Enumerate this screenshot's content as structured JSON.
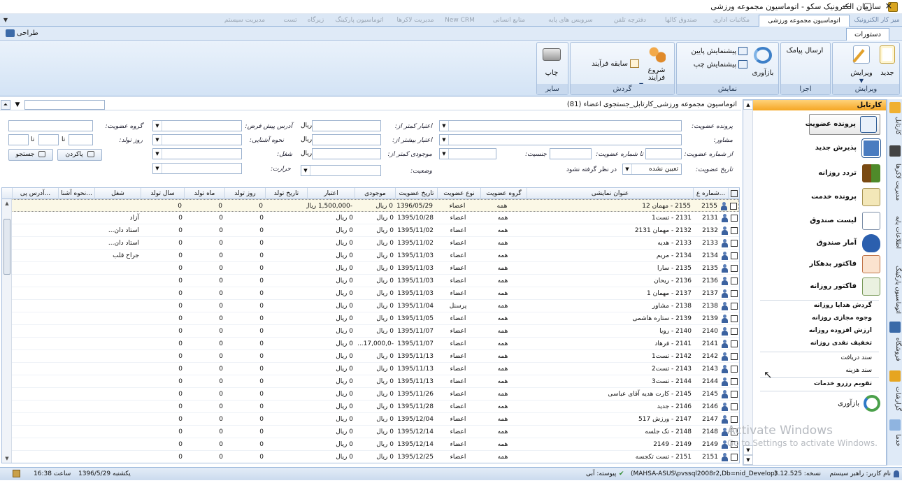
{
  "window": {
    "title": "سازمان الکترونیک سکو - اتوماسیون مجموعه ورزشی",
    "controls": [
      "—",
      "▢",
      "✕"
    ]
  },
  "tabs": [
    {
      "label": "میز کار الکترونیک"
    },
    {
      "label": "اتوماسیون مجموعه ورزشی"
    },
    {
      "label": "مکاتبات اداری"
    },
    {
      "label": "صندوق کالها"
    },
    {
      "label": "دفترچه تلفن"
    },
    {
      "label": "سرویس های پایه"
    },
    {
      "label": "منابع انسانی"
    },
    {
      "label": "New CRM"
    },
    {
      "label": "مدیریت لاکرها"
    },
    {
      "label": "اتوماسیون پارکینگ"
    },
    {
      "label": "زیرگاه"
    },
    {
      "label": "تست"
    },
    {
      "label": "مدیریت سیستم"
    }
  ],
  "subtabs": {
    "commands": "دستورات",
    "design": "طراحی"
  },
  "ribbon": {
    "groups": [
      {
        "caption": "ویرایش",
        "buttons": [
          {
            "label": "جدید"
          },
          {
            "label": "ویرایش"
          }
        ]
      },
      {
        "caption": "اجرا",
        "buttons": [
          {
            "label": "ارسال پیامک"
          }
        ]
      },
      {
        "caption": "نمایش",
        "buttons": [
          {
            "label": "بازآوری"
          },
          {
            "label": "پیشنمایش پایین"
          },
          {
            "label": "پیشنمایش چپ"
          }
        ]
      },
      {
        "caption": "گردش",
        "buttons": [
          {
            "label": "شروع فرآیند"
          },
          {
            "label": "سابقه فرآیند"
          }
        ]
      },
      {
        "caption": "سایر",
        "buttons": [
          {
            "label": "چاپ"
          }
        ]
      }
    ]
  },
  "breadcrumb": "اتوماسیون مجموعه ورزشی_کارتابل_جستجوی اعضاء (81)",
  "filters": {
    "membership_file": "پرونده عضویت:",
    "advisor": "مشاور:",
    "from_member_no": "از شماره عضویت:",
    "to_member_no": "تا شماره عضویت:",
    "gender": "جنسیت:",
    "membership_date": "تاریخ عضویت:",
    "status_value": "تعیین نشده",
    "not_considered": "در نظر گرفته نشود",
    "credit_min": "اعتبار کمتر از:",
    "credit_max": "اعتبار بیشتر از:",
    "balance_min": "موجودی کمتر از:",
    "status": "وضعیت:",
    "currency": "ریال",
    "default_address": "آدرس پیش فرض:",
    "acquaintance": "نحوه آشنایی:",
    "job": "شغل:",
    "temperature": "حرارت:",
    "member_group": "گروه عضویت:",
    "birth_day": "روز تولد:",
    "to_sep": "تا",
    "search_button": "جستجو",
    "clear_button": "پاکردن"
  },
  "grid": {
    "columns": [
      "شماره ع...",
      "عنوان نمایشی",
      "گروه عضویت",
      "نوع عضویت",
      "تاریخ عضویت",
      "موجودی",
      "اعتبار",
      "تاریخ تولد",
      "روز تولد",
      "ماه تولد",
      "سال تولد",
      "شغل",
      "نحوه آشنا...",
      "آدرس پی..."
    ],
    "rows": [
      {
        "no": "2155",
        "title": "2155 - مهمان 12",
        "group": "همه",
        "type": "اعضاء",
        "date": "1396/05/29",
        "balance": "0 ریال",
        "credit": "-1,500,000 ریال",
        "bday": "0",
        "bmonth": "0",
        "byear": "0",
        "job": "",
        "acq": ""
      },
      {
        "no": "2131",
        "title": "2131 - تست1",
        "group": "همه",
        "type": "اعضاء",
        "date": "1395/10/28",
        "balance": "0 ریال",
        "credit": "0 ریال",
        "bday": "0",
        "bmonth": "0",
        "byear": "0",
        "job": "آزاد",
        "acq": ""
      },
      {
        "no": "2132",
        "title": "2132 - مهمان 2131",
        "group": "همه",
        "type": "اعضاء",
        "date": "1395/11/02",
        "balance": "0 ریال",
        "credit": "0 ریال",
        "bday": "0",
        "bmonth": "0",
        "byear": "0",
        "job": "استاد دان...",
        "acq": ""
      },
      {
        "no": "2133",
        "title": "2133 - هدیه",
        "group": "همه",
        "type": "اعضاء",
        "date": "1395/11/02",
        "balance": "0 ریال",
        "credit": "0 ریال",
        "bday": "0",
        "bmonth": "0",
        "byear": "0",
        "job": "استاد دان...",
        "acq": ""
      },
      {
        "no": "2134",
        "title": "2134 - مریم",
        "group": "همه",
        "type": "اعضاء",
        "date": "1395/11/03",
        "balance": "0 ریال",
        "credit": "0 ریال",
        "bday": "0",
        "bmonth": "0",
        "byear": "0",
        "job": "جراح قلب",
        "acq": ""
      },
      {
        "no": "2135",
        "title": "2135 - سارا",
        "group": "همه",
        "type": "اعضاء",
        "date": "1395/11/03",
        "balance": "0 ریال",
        "credit": "0 ریال",
        "bday": "0",
        "bmonth": "0",
        "byear": "0",
        "job": "",
        "acq": ""
      },
      {
        "no": "2136",
        "title": "2136 - ریحان",
        "group": "همه",
        "type": "اعضاء",
        "date": "1395/11/03",
        "balance": "0 ریال",
        "credit": "0 ریال",
        "bday": "0",
        "bmonth": "0",
        "byear": "0",
        "job": "",
        "acq": ""
      },
      {
        "no": "2137",
        "title": "2137 - مهمان 1",
        "group": "همه",
        "type": "اعضاء",
        "date": "1395/11/03",
        "balance": "0 ریال",
        "credit": "0 ریال",
        "bday": "0",
        "bmonth": "0",
        "byear": "0",
        "job": "",
        "acq": ""
      },
      {
        "no": "2138",
        "title": "2138 - مشاور",
        "group": "همه",
        "type": "پرسنل",
        "date": "1395/11/04",
        "balance": "0 ریال",
        "credit": "0 ریال",
        "bday": "0",
        "bmonth": "0",
        "byear": "0",
        "job": "",
        "acq": ""
      },
      {
        "no": "2139",
        "title": "2139 - ستاره هاشمی",
        "group": "همه",
        "type": "اعضاء",
        "date": "1395/11/05",
        "balance": "0 ریال",
        "credit": "0 ریال",
        "bday": "0",
        "bmonth": "0",
        "byear": "0",
        "job": "",
        "acq": ""
      },
      {
        "no": "2140",
        "title": "2140 - رویا",
        "group": "همه",
        "type": "اعضاء",
        "date": "1395/11/07",
        "balance": "0 ریال",
        "credit": "0 ریال",
        "bday": "0",
        "bmonth": "0",
        "byear": "0",
        "job": "",
        "acq": ""
      },
      {
        "no": "2141",
        "title": "2141 - فرهاد",
        "group": "همه",
        "type": "اعضاء",
        "date": "1395/11/07",
        "balance": "-17,000,0...",
        "credit": "0 ریال",
        "bday": "0",
        "bmonth": "0",
        "byear": "0",
        "job": "",
        "acq": ""
      },
      {
        "no": "2142",
        "title": "2142 - تست1",
        "group": "همه",
        "type": "اعضاء",
        "date": "1395/11/13",
        "balance": "0 ریال",
        "credit": "0 ریال",
        "bday": "0",
        "bmonth": "0",
        "byear": "0",
        "job": "",
        "acq": ""
      },
      {
        "no": "2143",
        "title": "2143 - تست2",
        "group": "همه",
        "type": "اعضاء",
        "date": "1395/11/13",
        "balance": "0 ریال",
        "credit": "0 ریال",
        "bday": "0",
        "bmonth": "0",
        "byear": "0",
        "job": "",
        "acq": ""
      },
      {
        "no": "2144",
        "title": "2144 - تست3",
        "group": "همه",
        "type": "اعضاء",
        "date": "1395/11/13",
        "balance": "0 ریال",
        "credit": "0 ریال",
        "bday": "0",
        "bmonth": "0",
        "byear": "0",
        "job": "",
        "acq": ""
      },
      {
        "no": "2145",
        "title": "2145 - کارت هدیه آقای عباسی",
        "group": "همه",
        "type": "اعضاء",
        "date": "1395/11/26",
        "balance": "0 ریال",
        "credit": "0 ریال",
        "bday": "0",
        "bmonth": "0",
        "byear": "0",
        "job": "",
        "acq": ""
      },
      {
        "no": "2146",
        "title": "2146 - جدید",
        "group": "همه",
        "type": "اعضاء",
        "date": "1395/11/28",
        "balance": "0 ریال",
        "credit": "0 ریال",
        "bday": "0",
        "bmonth": "0",
        "byear": "0",
        "job": "",
        "acq": ""
      },
      {
        "no": "2147",
        "title": "2147 - ورزش 517",
        "group": "همه",
        "type": "اعضاء",
        "date": "1395/12/04",
        "balance": "0 ریال",
        "credit": "0 ریال",
        "bday": "0",
        "bmonth": "0",
        "byear": "0",
        "job": "",
        "acq": ""
      },
      {
        "no": "2148",
        "title": "2148 - تک جلسه",
        "group": "همه",
        "type": "اعضاء",
        "date": "1395/12/14",
        "balance": "0 ریال",
        "credit": "0 ریال",
        "bday": "0",
        "bmonth": "0",
        "byear": "0",
        "job": "",
        "acq": ""
      },
      {
        "no": "2149",
        "title": "2149 - 2149",
        "group": "همه",
        "type": "اعضاء",
        "date": "1395/12/14",
        "balance": "0 ریال",
        "credit": "0 ریال",
        "bday": "0",
        "bmonth": "0",
        "byear": "0",
        "job": "",
        "acq": ""
      },
      {
        "no": "2151",
        "title": "2151 - تست تکجسه",
        "group": "همه",
        "type": "اعضاء",
        "date": "1395/12/25",
        "balance": "0 ریال",
        "credit": "0 ریال",
        "bday": "0",
        "bmonth": "0",
        "byear": "0",
        "job": "",
        "acq": ""
      }
    ]
  },
  "rightpanel": {
    "header": "کارتابل",
    "items": [
      {
        "label": "پرونده عضویت"
      },
      {
        "label": "پذیرش جدید"
      },
      {
        "label": "تردد روزانه"
      },
      {
        "label": "پرونده خدمت"
      },
      {
        "label": "لیست صندوق"
      },
      {
        "label": "آمار صندوق"
      },
      {
        "label": "فاکتور بدهکار"
      },
      {
        "label": "فاکتور روزانه"
      }
    ],
    "links": [
      {
        "label": "گردش هدایا روزانه"
      },
      {
        "label": "وجوه مجازی روزانه"
      },
      {
        "label": "ارزش افزوده روزانه"
      },
      {
        "label": "تخفیف نقدی روزانه"
      },
      {
        "label": "سند دریافت"
      },
      {
        "label": "سند هزینه"
      },
      {
        "label": "تقویم رزرو خدمات"
      }
    ],
    "refresh": "بازآوری"
  },
  "vbar": [
    "کارتابل",
    "مدیریت لاکرها",
    "اطلاعات پایه",
    "اتوماسیون پارکینگ",
    "فروشگاه",
    "گزارشات",
    "خدما"
  ],
  "status": {
    "user": "نام کاربر: راهبر سیستم",
    "version": "نسخه: 3.12.525",
    "db": "(MAHSA-ASUS\\pvssql2008r2,Db=nid_Develop)",
    "connection": "پیوسته: آبی",
    "date": "یکشنبه 1396/5/29",
    "time": "ساعت 16:38"
  },
  "watermark": {
    "line1": "Activate Windows",
    "line2": "Go to Settings to activate Windows."
  }
}
